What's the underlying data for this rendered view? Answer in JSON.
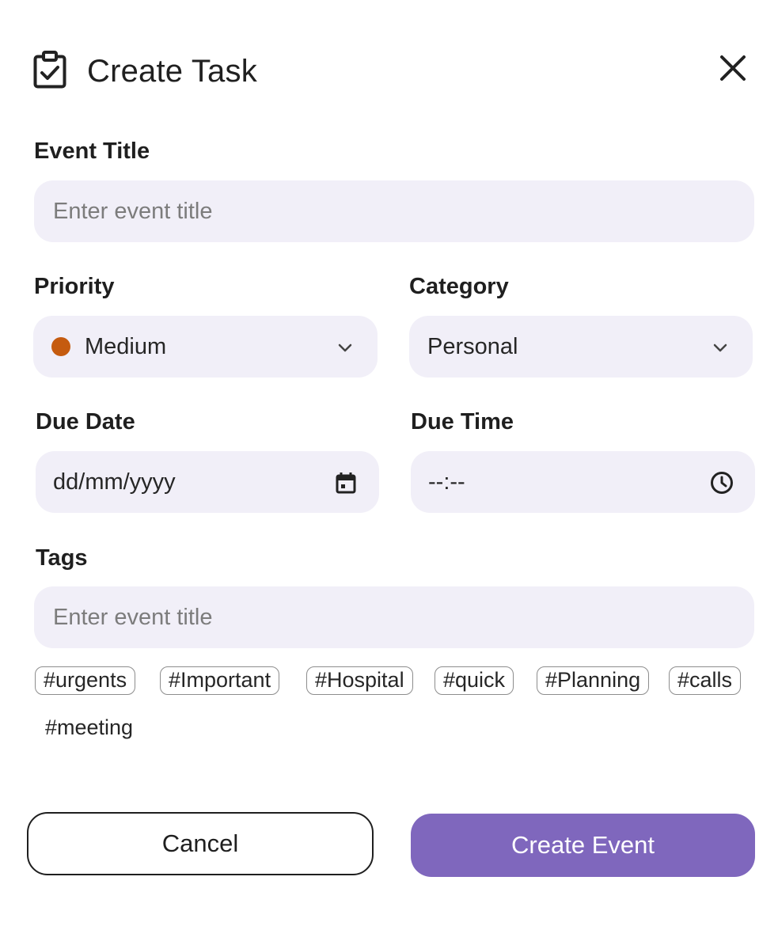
{
  "header": {
    "title": "Create Task",
    "icon": "clipboard-check-icon",
    "close_icon": "close-icon"
  },
  "event_title": {
    "label": "Event Title",
    "placeholder": "Enter event title",
    "value": ""
  },
  "priority": {
    "label": "Priority",
    "value": "Medium",
    "dot_color": "#c55b0f"
  },
  "category": {
    "label": "Category",
    "value": "Personal"
  },
  "due_date": {
    "label": "Due Date",
    "value": "dd/mm/yyyy",
    "icon": "calendar-icon"
  },
  "due_time": {
    "label": "Due Time",
    "value": "--:--",
    "icon": "clock-icon"
  },
  "tags": {
    "label": "Tags",
    "placeholder": "Enter event title",
    "items": [
      "#urgents",
      "#Important",
      "#Hospital",
      "#quick",
      "#Planning",
      "#calls",
      "#meeting"
    ]
  },
  "actions": {
    "cancel_label": "Cancel",
    "create_label": "Create Event"
  },
  "colors": {
    "accent": "#7f67bd",
    "field_bg": "#f1eff8",
    "priority_medium": "#c55b0f"
  }
}
